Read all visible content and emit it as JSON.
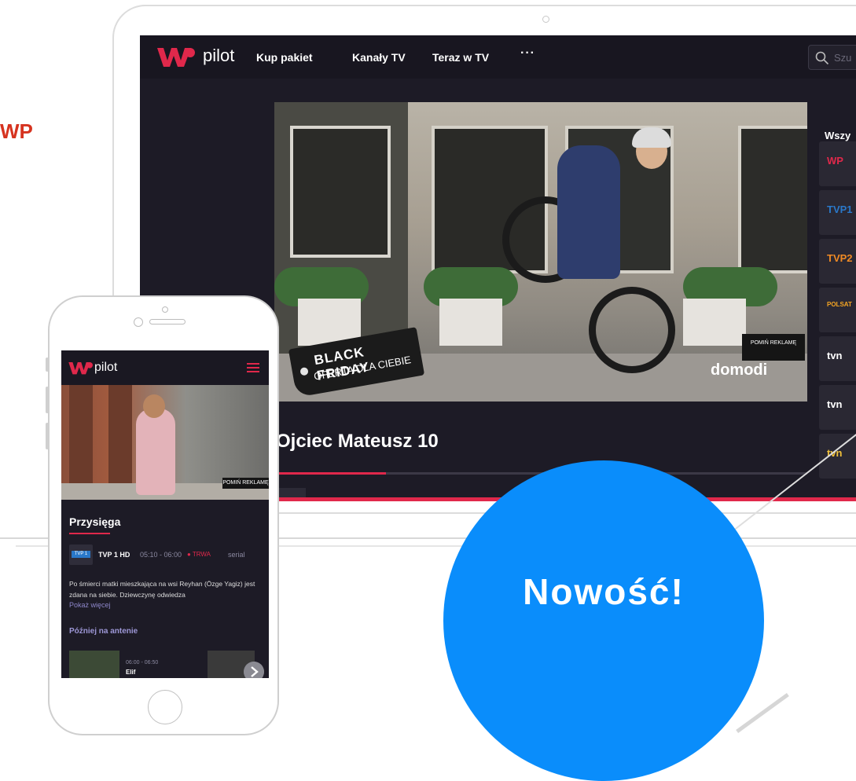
{
  "side_label": "WP",
  "laptop": {
    "logo_text": "pilot",
    "nav": [
      "Kup pakiet",
      "Kanały TV",
      "Teraz w TV"
    ],
    "nav_more": "···",
    "search_placeholder": "Szu",
    "ad_badge": {
      "line1": "BLACK FRIDAY",
      "line2": "OFERTA DLA CIEBIE"
    },
    "skip_ad": "POMIŃ REKLAMĘ",
    "ad_brand": "domodi",
    "program_title": "Ojciec Mateusz 10",
    "progress": 0.21,
    "channels_header": "Wszy",
    "channels": [
      {
        "label": "WP",
        "color": "#e0284b"
      },
      {
        "label": "TVP1",
        "color": "#2a78c9"
      },
      {
        "label": "TVP2",
        "color": "#f08a24"
      },
      {
        "label": "POLSAT",
        "color": "#f6a623"
      },
      {
        "label": "tvn",
        "color": "#ffffff"
      },
      {
        "label": "tvn",
        "color": "#ffffff"
      },
      {
        "label": "tvn",
        "color": "#f0c03a"
      }
    ]
  },
  "phone": {
    "logo_text": "pilot",
    "skip_ad": "POMIŃ REKLAMĘ",
    "title": "Przysięga",
    "channel_badge": "TVP 1",
    "channel_name": "TVP 1 HD",
    "time": "05:10 - 06:00",
    "live": "● TRWA",
    "kind": "serial",
    "description": "Po śmierci matki mieszkająca na wsi Reyhan (Özge Yagiz) jest zdana na siebie. Dziewczynę odwiedza",
    "show_more": "Pokaż więcej",
    "later_header": "Później na antenie",
    "next_time": "06:00 - 06:50",
    "next_title": "Elif"
  },
  "badge": {
    "text": "Nowość!",
    "color": "#0a8dfb"
  }
}
